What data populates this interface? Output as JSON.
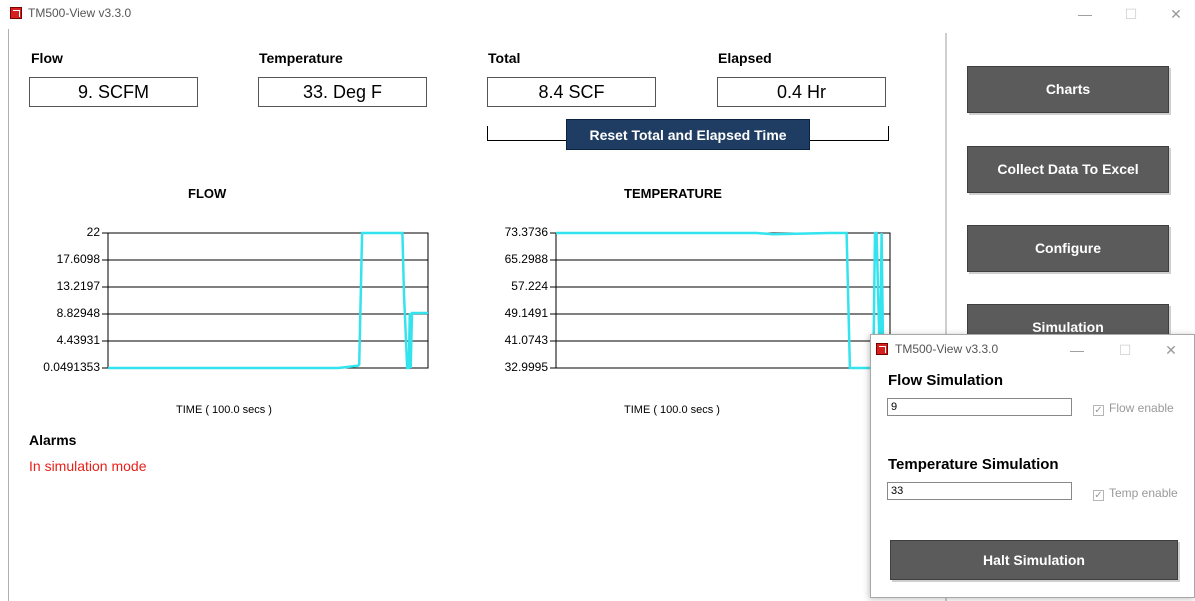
{
  "main_window": {
    "title": "TM500-View v3.3.0",
    "controls": {
      "minimize": "—",
      "maximize": "☐",
      "close": "✕"
    }
  },
  "readouts": {
    "flow": {
      "label": "Flow",
      "value": "9. SCFM"
    },
    "temperature": {
      "label": "Temperature",
      "value": "33. Deg F"
    },
    "total": {
      "label": "Total",
      "value": "8.4 SCF"
    },
    "elapsed": {
      "label": "Elapsed",
      "value": "0.4  Hr"
    }
  },
  "reset_button": "Reset Total and Elapsed Time",
  "sidebar": {
    "buttons": [
      "Charts",
      "Collect Data To Excel",
      "Configure",
      "Simulation"
    ]
  },
  "alarms": {
    "label": "Alarms",
    "message": "In simulation mode"
  },
  "chart_data": [
    {
      "type": "line",
      "title": "FLOW",
      "xlabel": "TIME ( 100.0 secs )",
      "ylabel": "",
      "yticks": [
        "22",
        "17.6098",
        "13.2197",
        "8.82948",
        "4.43931",
        "0.0491353"
      ],
      "ylim": [
        0.0491353,
        22
      ],
      "xlim": [
        0,
        100
      ],
      "grid": true,
      "line_color": "#33e4ee",
      "series": [
        {
          "x": [
            0,
            65,
            72,
            78,
            78.5,
            79.4,
            80,
            81,
            90,
            92,
            92.5,
            93.5,
            94,
            94.3,
            94.6,
            95,
            97,
            100
          ],
          "y": [
            0.05,
            0.05,
            0.05,
            0.4,
            0.6,
            22,
            22,
            22,
            22,
            22,
            12,
            0.05,
            0.05,
            9,
            0.05,
            9,
            9,
            9
          ]
        }
      ]
    },
    {
      "type": "line",
      "title": "TEMPERATURE",
      "xlabel": "TIME ( 100.0 secs )",
      "ylabel": "",
      "yticks": [
        "73.3736",
        "65.2988",
        "57.224",
        "49.1491",
        "41.0743",
        "32.9995"
      ],
      "ylim": [
        32.9995,
        73.3736
      ],
      "xlim": [
        0,
        100
      ],
      "grid": true,
      "line_color": "#33e4ee",
      "series": [
        {
          "x": [
            0,
            60,
            65,
            82,
            84,
            87,
            88,
            94,
            95,
            95.5,
            96,
            97,
            97.5,
            98
          ],
          "y": [
            73.37,
            73.37,
            73,
            73.37,
            73.37,
            73.37,
            33,
            33,
            33,
            73.37,
            73.37,
            33,
            73.37,
            33
          ]
        }
      ]
    }
  ],
  "popup": {
    "title": "TM500-View v3.3.0",
    "controls": {
      "minimize": "—",
      "maximize": "☐",
      "close": "✕"
    },
    "flow_sim": {
      "heading": "Flow Simulation",
      "value": "9",
      "checkbox": "Flow enable"
    },
    "temp_sim": {
      "heading": "Temperature Simulation",
      "value": "33",
      "checkbox": "Temp enable"
    },
    "halt_button": "Halt Simulation"
  }
}
